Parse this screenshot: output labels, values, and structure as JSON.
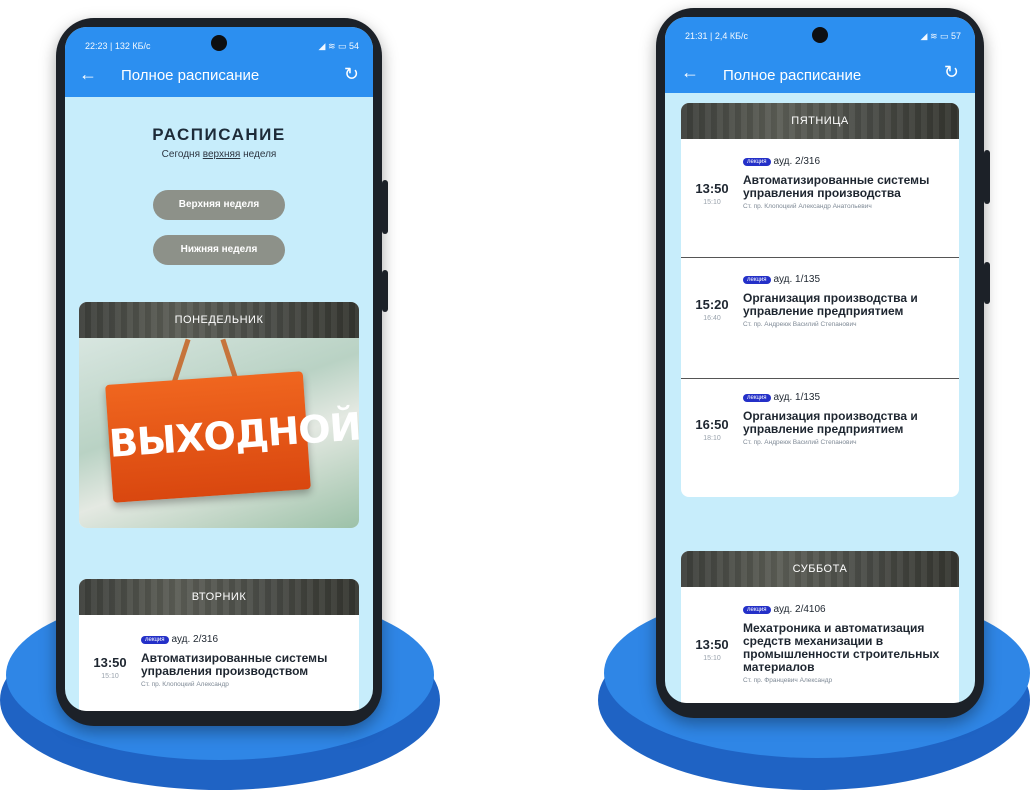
{
  "left_phone": {
    "status": {
      "time": "22:23 | 132 КБ/с",
      "battery": "54"
    },
    "appbar": {
      "title": "Полное расписание"
    },
    "heading": "РАСПИСАНИЕ",
    "subtitle_prefix": "Сегодня",
    "subtitle_week": "верхняя",
    "subtitle_suffix": "неделя",
    "buttons": [
      "Верхняя неделя",
      "Нижняя неделя"
    ],
    "days": [
      {
        "name": "ПОНЕДЕЛЬНИК",
        "holiday_text": "ВЫХОДНОЙ"
      },
      {
        "name": "ВТОРНИК",
        "lessons": [
          {
            "start": "13:50",
            "end": "15:10",
            "type": "лекция",
            "room": "ауд. 2/316",
            "subject": "Автоматизированные системы управления производством",
            "teacher": "Ст. пр. Клопоцкий Александр"
          }
        ]
      }
    ]
  },
  "right_phone": {
    "status": {
      "time": "21:31 | 2,4 КБ/с",
      "battery": "57"
    },
    "appbar": {
      "title": "Полное расписание"
    },
    "days": [
      {
        "name": "ПЯТНИЦА",
        "lessons": [
          {
            "start": "13:50",
            "end": "15:10",
            "type": "лекция",
            "room": "ауд. 2/316",
            "subject": "Автоматизированные системы управления производства",
            "teacher": "Ст. пр. Клопоцкий Александр Анатольевич"
          },
          {
            "start": "15:20",
            "end": "16:40",
            "type": "лекция",
            "room": "ауд. 1/135",
            "subject": "Организация производства и управление предприятием",
            "teacher": "Ст. пр. Андреюк Василий Степанович"
          },
          {
            "start": "16:50",
            "end": "18:10",
            "type": "лекция",
            "room": "ауд. 1/135",
            "subject": "Организация производства и управление предприятием",
            "teacher": "Ст. пр. Андреюк Василий Степанович"
          }
        ]
      },
      {
        "name": "СУББОТА",
        "lessons": [
          {
            "start": "13:50",
            "end": "15:10",
            "type": "лекция",
            "room": "ауд. 2/4106",
            "subject": "Мехатроника и автоматизация средств механизации в промышленности строительных материалов",
            "teacher": "Ст. пр. Францевич Александр"
          }
        ]
      }
    ]
  },
  "colors": {
    "appbar": "#2c8ff0",
    "screen_bg": "#c7edfb",
    "accent_tag": "#2430c8",
    "podium": "#2f86e6",
    "week_button": "#8d9189"
  },
  "icons": {
    "back": "arrow-left-icon",
    "refresh": "refresh-icon"
  }
}
